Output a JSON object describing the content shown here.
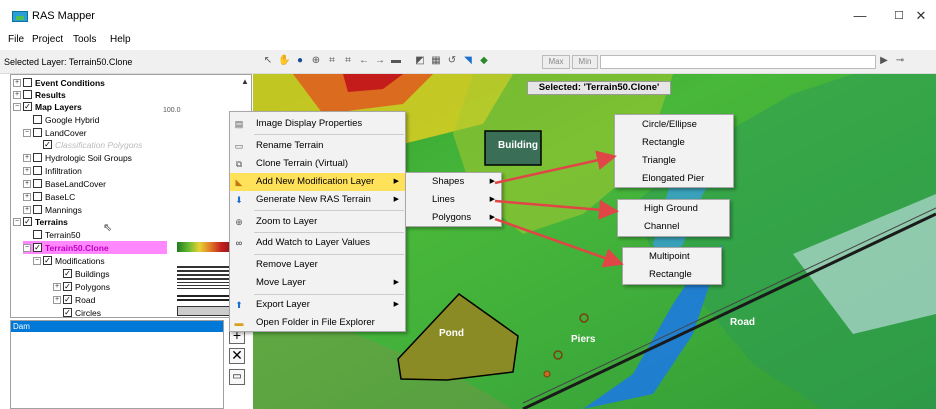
{
  "window": {
    "title": "RAS Mapper"
  },
  "window_controls": {
    "minimize": "—",
    "maximize": "☐",
    "close": "✕"
  },
  "menubar": {
    "items": [
      "File",
      "Project",
      "Tools",
      "Help"
    ]
  },
  "toolbar": {
    "selected_layer": "Selected Layer: Terrain50.Clone",
    "max_label": "Max",
    "min_label": "Min"
  },
  "tree": {
    "items": [
      {
        "label": "Event Conditions",
        "bold": true
      },
      {
        "label": "Results",
        "bold": true
      },
      {
        "label": "Map Layers",
        "bold": true
      },
      {
        "label": "Google Hybrid"
      },
      {
        "label": "LandCover"
      },
      {
        "label": "Classification Polygons"
      },
      {
        "label": "Hydrologic Soil Groups"
      },
      {
        "label": "Infiltration"
      },
      {
        "label": "BaseLandCover"
      },
      {
        "label": "BaseLC"
      },
      {
        "label": "Mannings"
      },
      {
        "label": "Terrains",
        "bold": true
      },
      {
        "label": "Terrain50"
      },
      {
        "label": "Terrain50.Clone",
        "bold": true
      },
      {
        "label": "Modifications"
      },
      {
        "label": "Buildings"
      },
      {
        "label": "Polygons"
      },
      {
        "label": "Road"
      },
      {
        "label": "Circles"
      }
    ],
    "partial_value": "100.0"
  },
  "dam_panel": {
    "header": "Dam"
  },
  "map": {
    "selected_banner": "Selected: 'Terrain50.Clone'",
    "labels": {
      "building": "Building",
      "pond": "Pond",
      "piers": "Piers",
      "road": "Road"
    }
  },
  "context_menu": {
    "items": [
      {
        "label": "Image Display Properties"
      },
      {
        "label": "Rename Terrain"
      },
      {
        "label": "Clone Terrain (Virtual)"
      },
      {
        "label": "Add New Modification Layer"
      },
      {
        "label": "Generate New RAS Terrain"
      },
      {
        "label": "Zoom to Layer"
      },
      {
        "label": "Add Watch to Layer Values"
      },
      {
        "label": "Remove Layer"
      },
      {
        "label": "Move Layer"
      },
      {
        "label": "Export Layer"
      },
      {
        "label": "Open Folder in File Explorer"
      }
    ]
  },
  "submenu_type": {
    "items": [
      "Shapes",
      "Lines",
      "Polygons"
    ]
  },
  "submenu_shapes": {
    "items": [
      "Circle/Ellipse",
      "Rectangle",
      "Triangle",
      "Elongated Pier"
    ]
  },
  "submenu_lines": {
    "items": [
      "High Ground",
      "Channel"
    ]
  },
  "submenu_polygons": {
    "items": [
      "Multipoint",
      "Rectangle"
    ]
  },
  "colors": {
    "highlight": "#ffe15a",
    "tree_selected": "#ff88ff",
    "arrow": "#e04646",
    "accent": "#0078d7"
  }
}
